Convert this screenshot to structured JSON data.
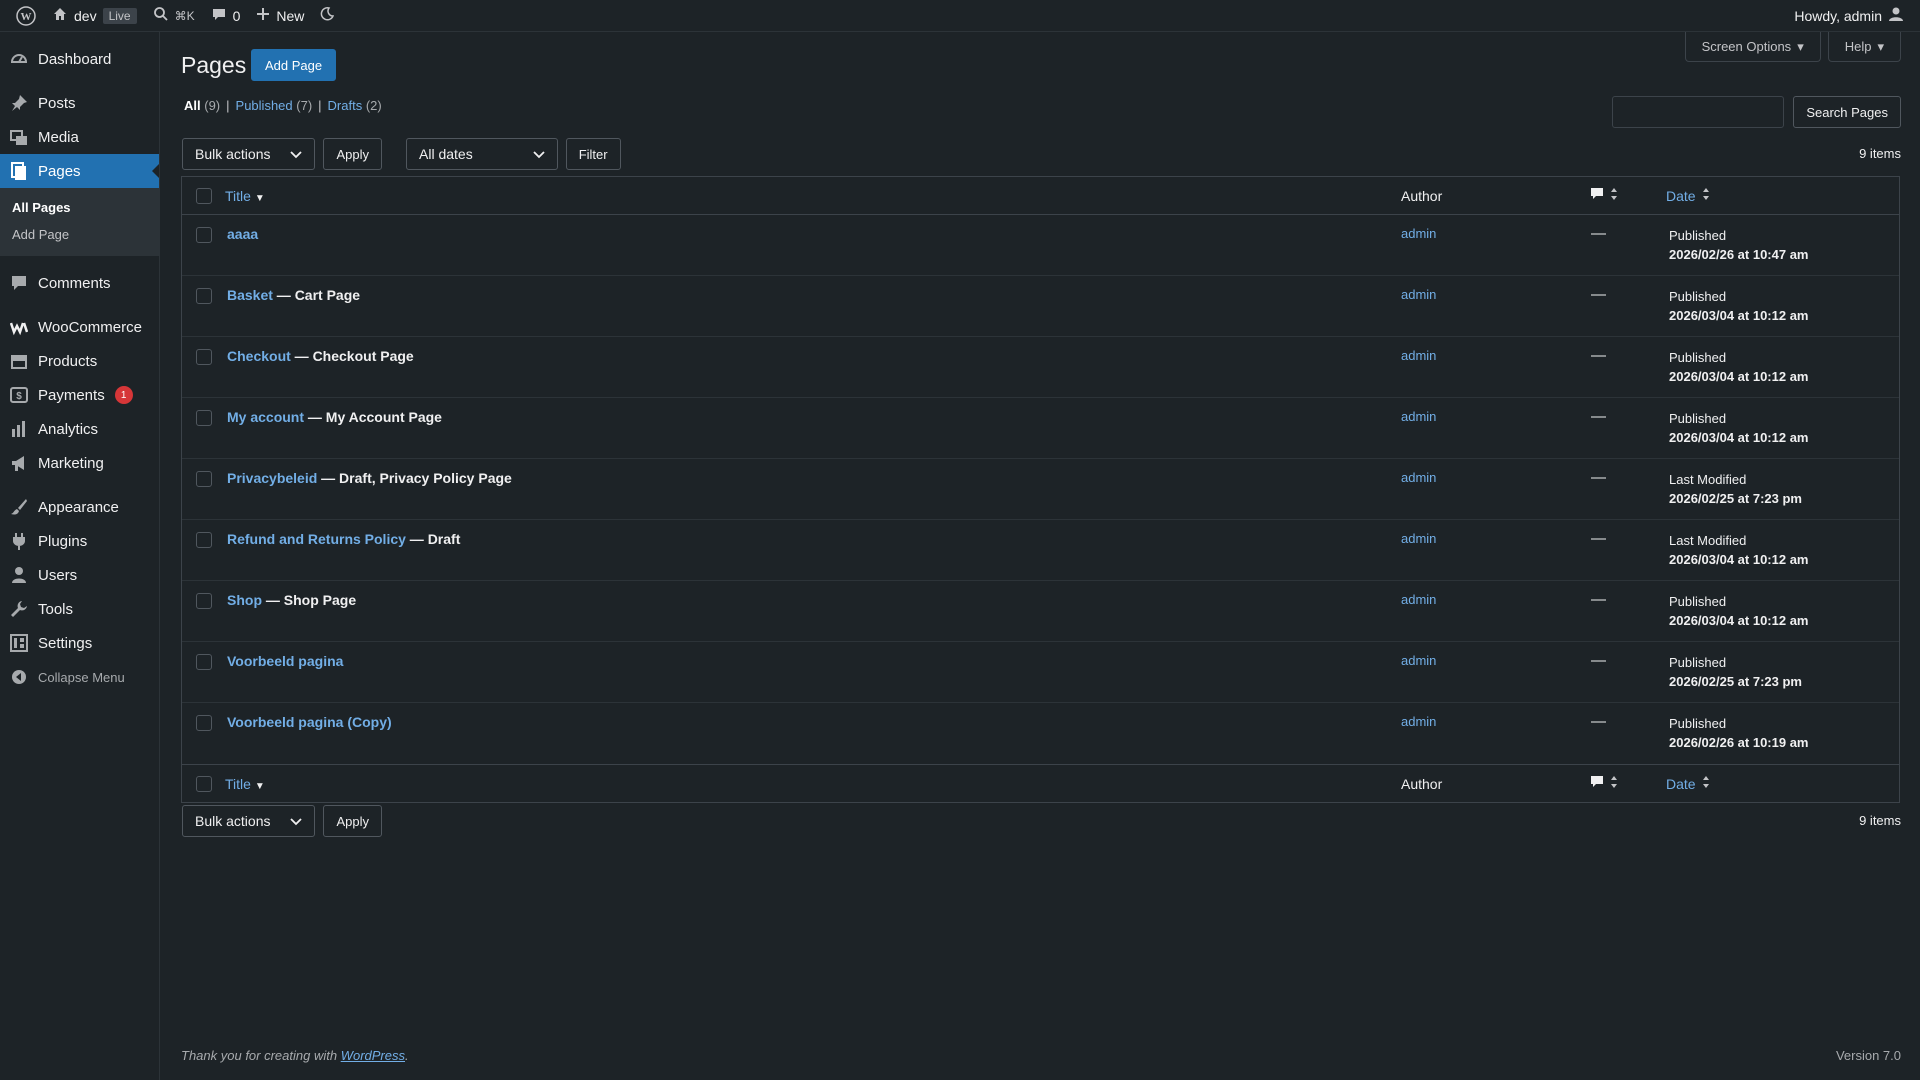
{
  "adminbar": {
    "site_name": "dev",
    "live_label": "Live",
    "kbd_shortcut": "⌘K",
    "comments_count": "0",
    "new_label": "New",
    "howdy": "Howdy, admin"
  },
  "sidebar": {
    "items": [
      {
        "label": "Dashboard",
        "icon": "dashboard-icon"
      },
      {
        "label": "Posts",
        "icon": "pin-icon"
      },
      {
        "label": "Media",
        "icon": "media-icon"
      },
      {
        "label": "Pages",
        "icon": "pages-icon"
      },
      {
        "label": "Comments",
        "icon": "comment-icon"
      },
      {
        "label": "WooCommerce",
        "icon": "woo-icon"
      },
      {
        "label": "Products",
        "icon": "products-icon"
      },
      {
        "label": "Payments",
        "icon": "payments-icon"
      },
      {
        "label": "Analytics",
        "icon": "analytics-icon"
      },
      {
        "label": "Marketing",
        "icon": "megaphone-icon"
      },
      {
        "label": "Appearance",
        "icon": "brush-icon"
      },
      {
        "label": "Plugins",
        "icon": "plugin-icon"
      },
      {
        "label": "Users",
        "icon": "user-icon"
      },
      {
        "label": "Tools",
        "icon": "wrench-icon"
      },
      {
        "label": "Settings",
        "icon": "settings-icon"
      }
    ],
    "submenu": [
      "All Pages",
      "Add Page"
    ],
    "payments_badge": "1",
    "collapse_label": "Collapse Menu"
  },
  "main": {
    "title": "Pages",
    "add_page": "Add Page",
    "screen_options": "Screen Options",
    "help": "Help",
    "views": [
      {
        "label": "All",
        "count": "(9)"
      },
      {
        "label": "Published",
        "count": "(7)"
      },
      {
        "label": "Drafts",
        "count": "(2)"
      }
    ],
    "search_button": "Search Pages",
    "bulk_actions": "Bulk actions",
    "apply": "Apply",
    "all_dates": "All dates",
    "filter": "Filter",
    "items_count": "9 items"
  },
  "table": {
    "columns": {
      "title": "Title",
      "author": "Author",
      "date": "Date"
    },
    "rows": [
      {
        "title": "aaaa",
        "state": "",
        "author": "admin",
        "comments": "—",
        "status": "Published",
        "date": "2026/02/26 at 10:47 am"
      },
      {
        "title": "Basket",
        "state": " — Cart Page",
        "author": "admin",
        "comments": "—",
        "status": "Published",
        "date": "2026/03/04 at 10:12 am"
      },
      {
        "title": "Checkout",
        "state": " — Checkout Page",
        "author": "admin",
        "comments": "—",
        "status": "Published",
        "date": "2026/03/04 at 10:12 am"
      },
      {
        "title": "My account",
        "state": " — My Account Page",
        "author": "admin",
        "comments": "—",
        "status": "Published",
        "date": "2026/03/04 at 10:12 am"
      },
      {
        "title": "Privacybeleid",
        "state": " — Draft, Privacy Policy Page",
        "author": "admin",
        "comments": "—",
        "status": "Last Modified",
        "date": "2026/02/25 at 7:23 pm"
      },
      {
        "title": "Refund and Returns Policy",
        "state": " — Draft",
        "author": "admin",
        "comments": "—",
        "status": "Last Modified",
        "date": "2026/03/04 at 10:12 am"
      },
      {
        "title": "Shop",
        "state": " — Shop Page",
        "author": "admin",
        "comments": "—",
        "status": "Published",
        "date": "2026/03/04 at 10:12 am"
      },
      {
        "title": "Voorbeeld pagina",
        "state": "",
        "author": "admin",
        "comments": "—",
        "status": "Published",
        "date": "2026/02/25 at 7:23 pm"
      },
      {
        "title": "Voorbeeld pagina (Copy)",
        "state": "",
        "author": "admin",
        "comments": "—",
        "status": "Published",
        "date": "2026/02/26 at 10:19 am"
      }
    ]
  },
  "footer": {
    "thanks": "Thank you for creating with ",
    "wp_link": "WordPress",
    "period": ".",
    "version": "Version 7.0"
  },
  "colors": {
    "accent": "#2271b1",
    "link": "#72aee6",
    "background": "#1d2327",
    "badge": "#d63638"
  }
}
